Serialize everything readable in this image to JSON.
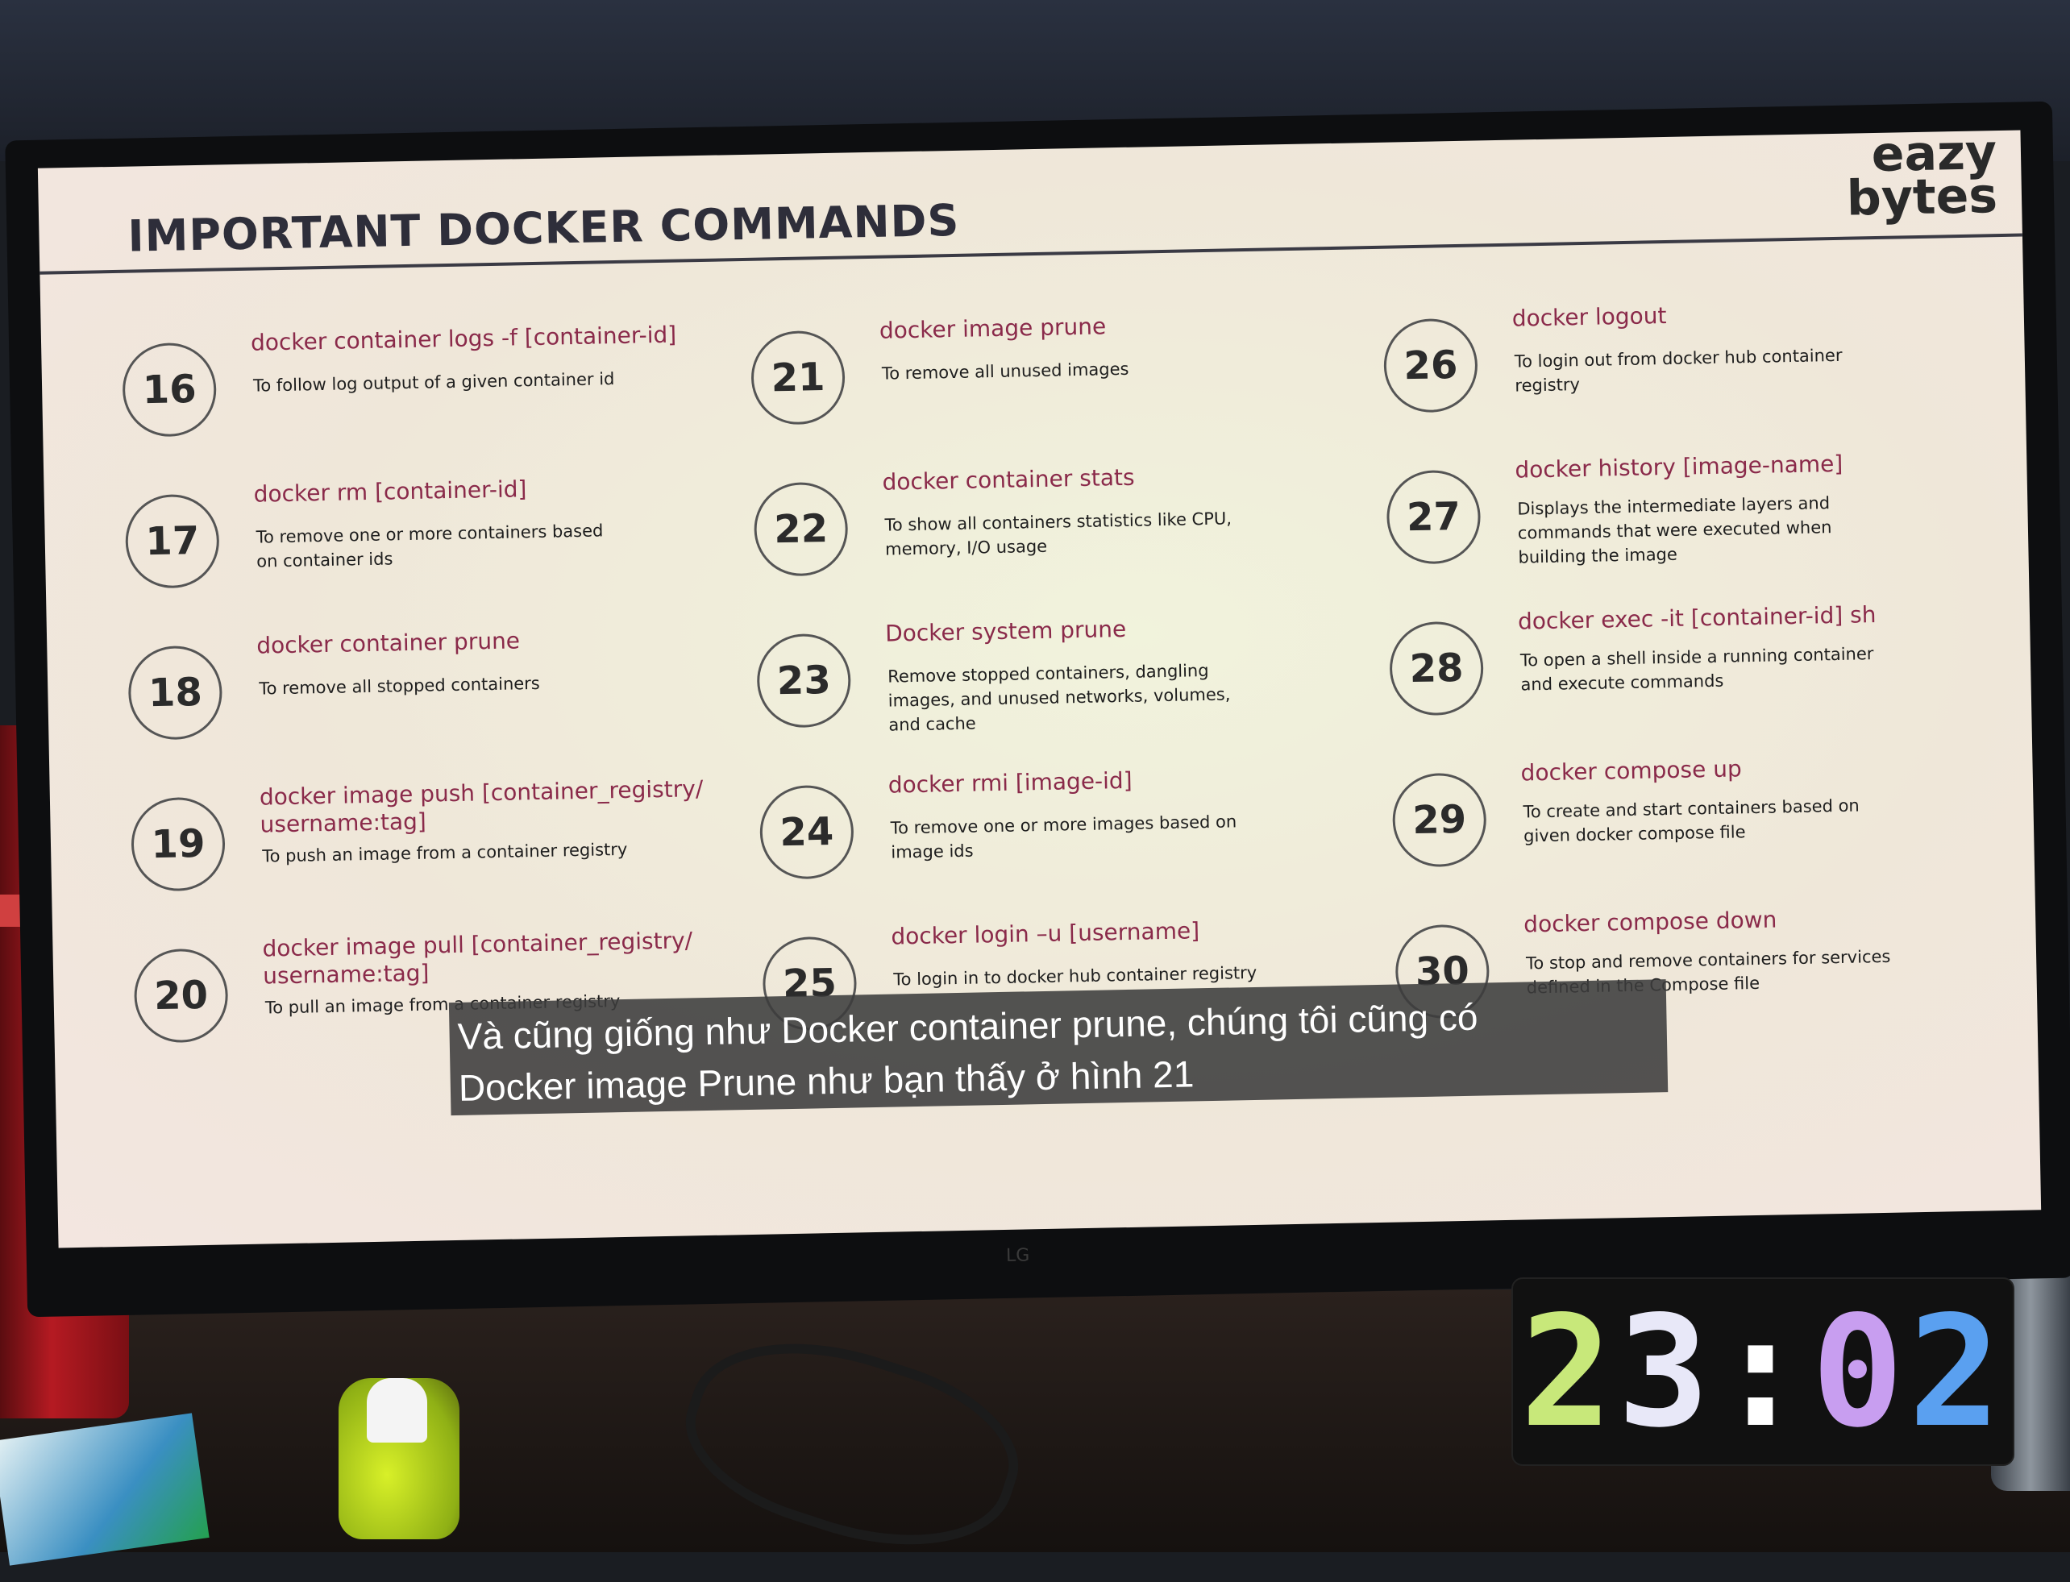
{
  "slide": {
    "title": "IMPORTANT DOCKER COMMANDS",
    "logo_line1": "eazy",
    "logo_line2": "bytes",
    "columns": [
      [
        {
          "num": "16",
          "cmd": "docker container logs -f [container-id]",
          "desc": "To follow log output of a given container id"
        },
        {
          "num": "17",
          "cmd": "docker rm [container-id]",
          "desc": "To remove one or more containers based on container ids"
        },
        {
          "num": "18",
          "cmd": "docker container prune",
          "desc": "To remove all stopped containers"
        },
        {
          "num": "19",
          "cmd": "docker image push [container_registry/ username:tag]",
          "desc": "To push an image from a container registry"
        },
        {
          "num": "20",
          "cmd": "docker image pull [container_registry/ username:tag]",
          "desc": "To pull an image from a container registry"
        }
      ],
      [
        {
          "num": "21",
          "cmd": "docker image prune",
          "desc": "To remove all unused images"
        },
        {
          "num": "22",
          "cmd": "docker container stats",
          "desc": "To show all containers statistics like CPU, memory, I/O usage"
        },
        {
          "num": "23",
          "cmd": "Docker system prune",
          "desc": "Remove stopped containers, dangling images, and unused networks, volumes, and cache"
        },
        {
          "num": "24",
          "cmd": "docker rmi [image-id]",
          "desc": "To remove one or more images based on image ids"
        },
        {
          "num": "25",
          "cmd": "docker login –u [username]",
          "desc": "To login in to docker hub container registry"
        }
      ],
      [
        {
          "num": "26",
          "cmd": "docker logout",
          "desc": "To login out from docker hub container registry"
        },
        {
          "num": "27",
          "cmd": "docker history [image-name]",
          "desc": "Displays the intermediate layers and commands that were executed when building the image"
        },
        {
          "num": "28",
          "cmd": "docker exec -it [container-id] sh",
          "desc": "To open a shell inside a running container and execute commands"
        },
        {
          "num": "29",
          "cmd": "docker compose up",
          "desc": "To create and start containers based on given docker compose file"
        },
        {
          "num": "30",
          "cmd": "docker compose down",
          "desc": "To stop and remove containers for services defined in the Compose file"
        }
      ]
    ]
  },
  "subtitle": {
    "line1": "Và cũng giống như Docker container prune, chúng tôi cũng có",
    "line2": "Docker image Prune như bạn thấy ở hình 21"
  },
  "monitor_brand": "LG",
  "clock": {
    "digits": [
      "2",
      "3",
      ":",
      "0",
      "2"
    ],
    "colors": [
      "#c8e87a",
      "#e8e8f8",
      "#ffffff",
      "#c89ef0",
      "#5aa0f0"
    ]
  }
}
